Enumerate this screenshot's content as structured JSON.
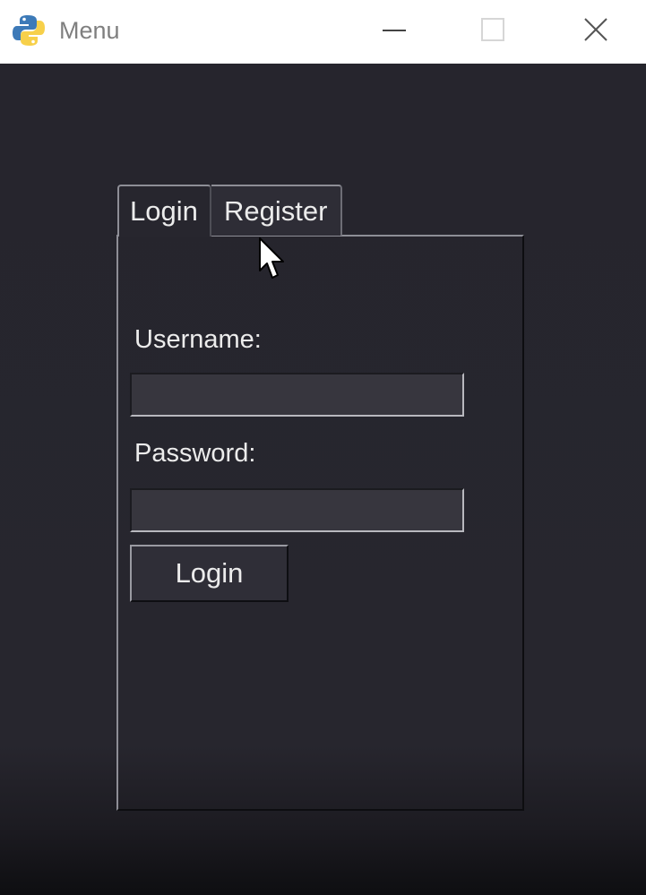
{
  "window": {
    "title": "Menu",
    "controls": {
      "minimize_icon": "minimize-icon",
      "maximize_icon": "maximize-icon",
      "close_icon": "close-icon"
    },
    "app_icon": "python-logo-icon"
  },
  "notebook": {
    "tabs": [
      {
        "label": "Login",
        "selected": true
      },
      {
        "label": "Register",
        "selected": false
      }
    ]
  },
  "login_form": {
    "username_label": "Username:",
    "username_value": "",
    "password_label": "Password:",
    "password_value": "",
    "login_button": "Login"
  },
  "colors": {
    "background": "#26252d",
    "titlebar": "#ffffff",
    "text": "#ececec",
    "entry_bg": "#37363e",
    "python_blue": "#3d7ab8",
    "python_yellow": "#f7d04a"
  }
}
